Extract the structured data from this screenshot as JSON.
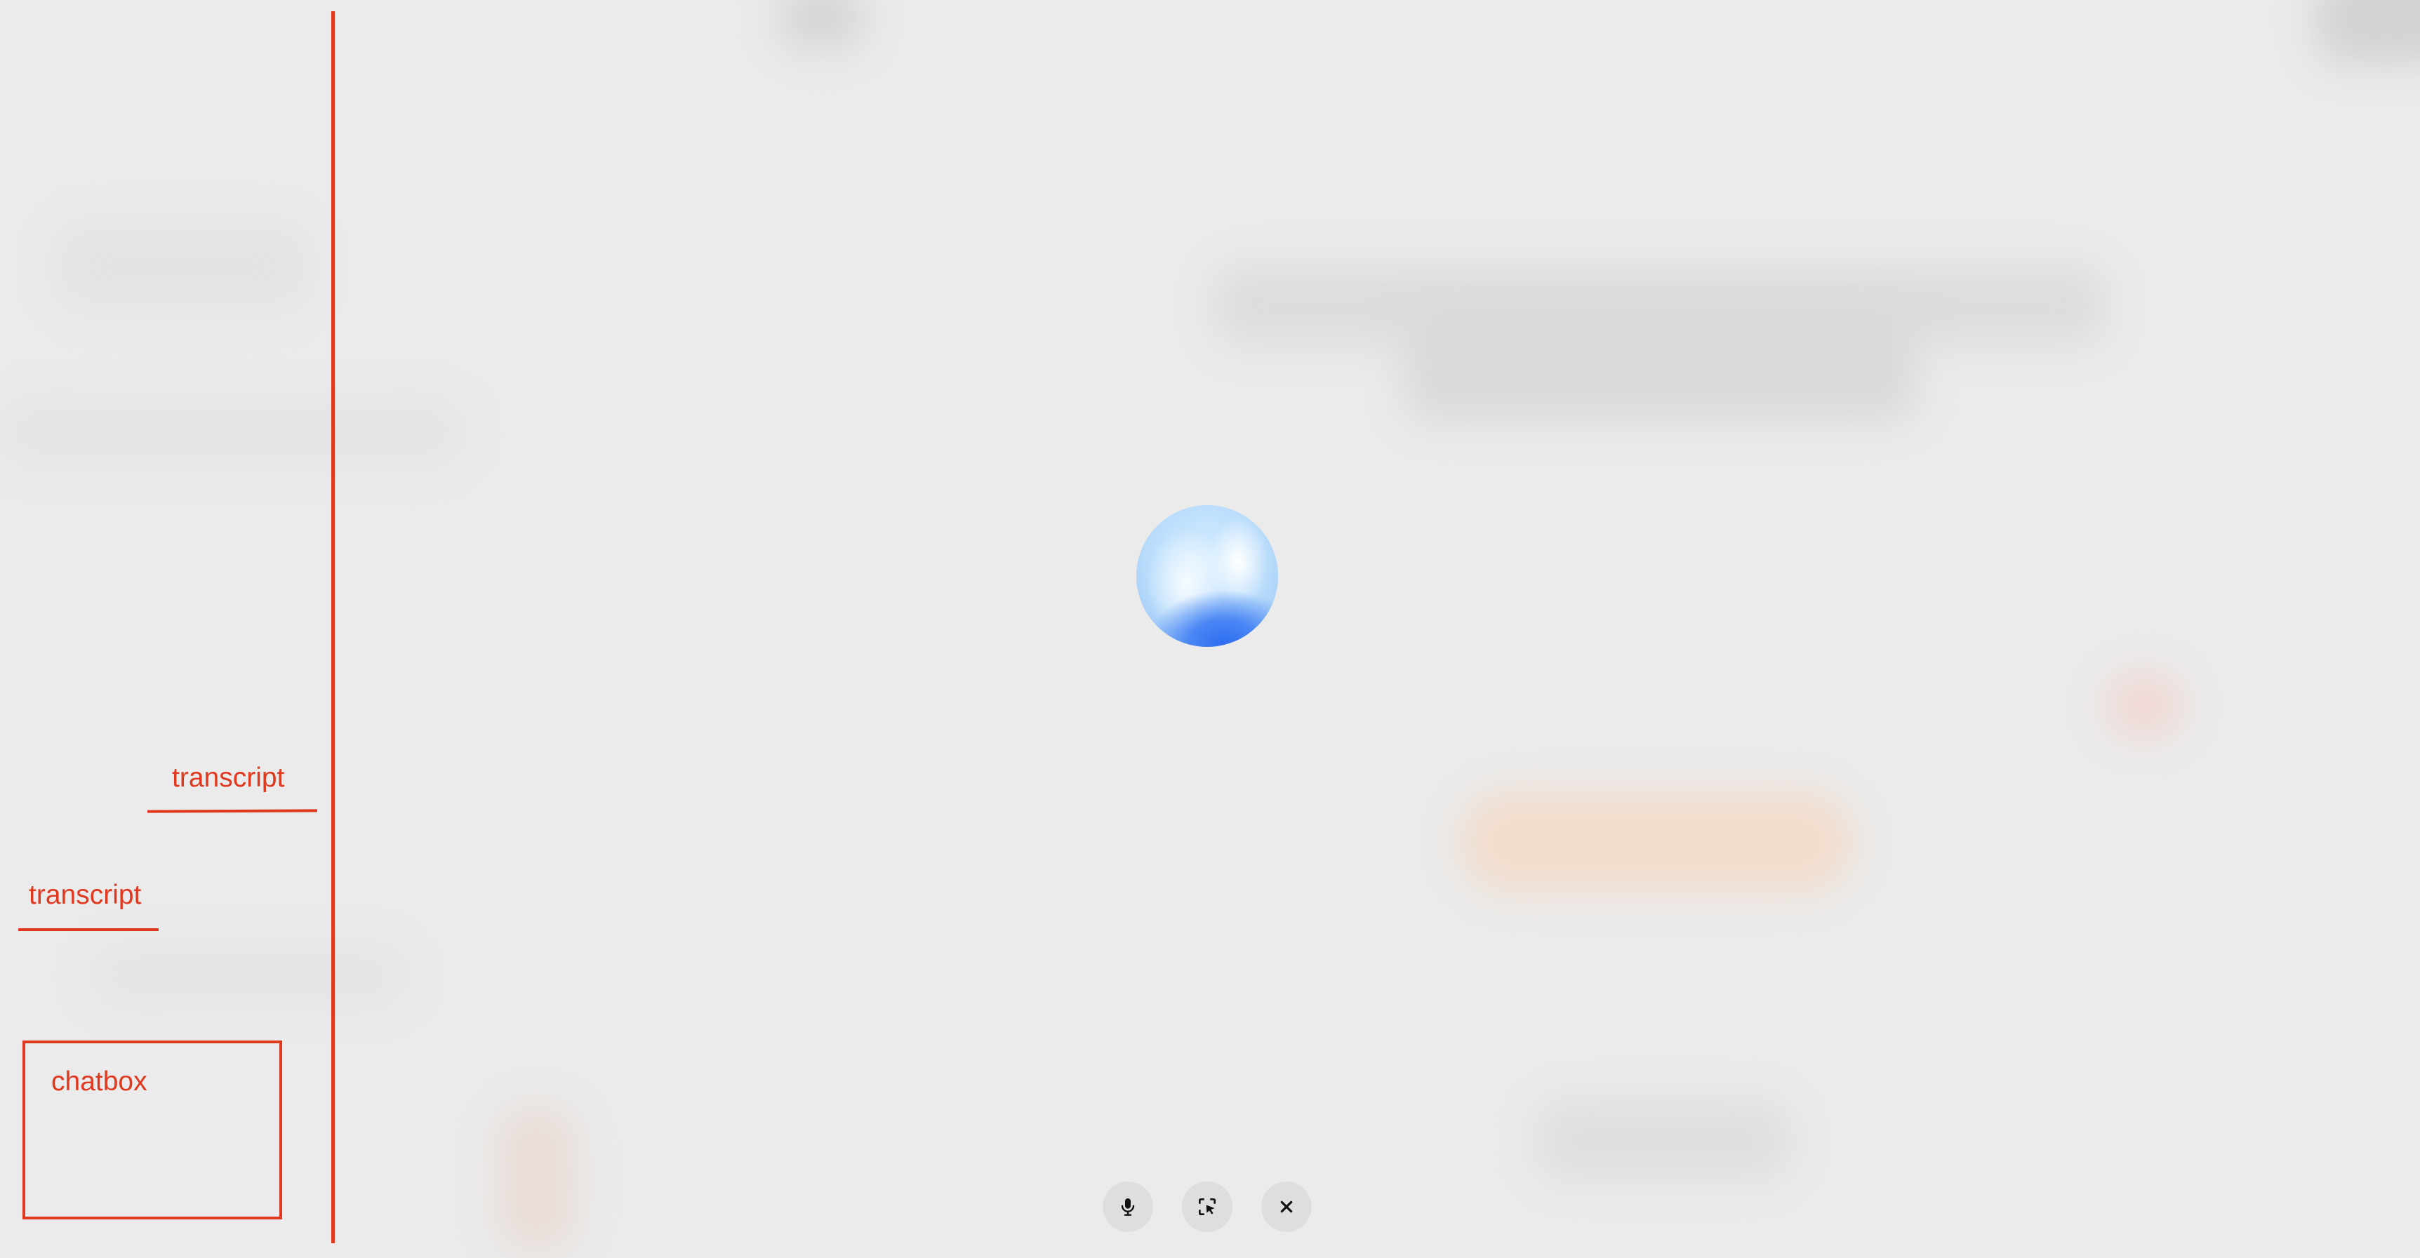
{
  "annotations": {
    "transcript_label_1": "transcript",
    "transcript_label_2": "transcript",
    "chatbox_label": "chatbox",
    "color": "#e0391f"
  },
  "orb": {
    "icon": "voice-assistant-orb",
    "colors": [
      "#d9efff",
      "#ffffff",
      "#2d6df0"
    ]
  },
  "controls": {
    "mic": {
      "icon": "microphone-icon"
    },
    "screen_share": {
      "icon": "screen-select-cursor-icon"
    },
    "close": {
      "icon": "close-icon"
    }
  },
  "theme": {
    "background": "#ebebeb",
    "button_background": "#dedede"
  }
}
